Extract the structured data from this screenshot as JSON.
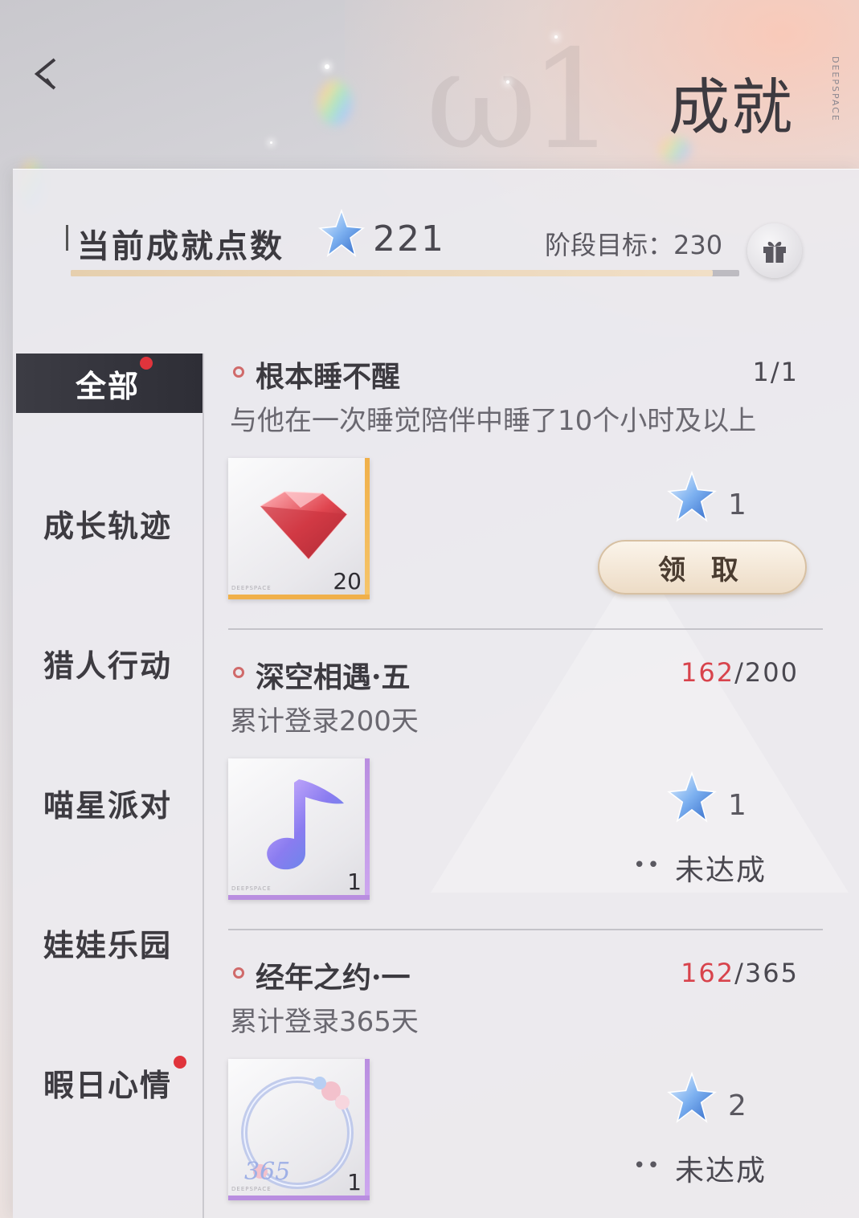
{
  "header": {
    "title": "成就",
    "brand_vertical": "DEEPSPACE"
  },
  "points": {
    "label": "当前成就点数",
    "value": "221",
    "goal_label": "阶段目标：230",
    "progress": 0.96
  },
  "sidebar": {
    "items": [
      {
        "label": "全部",
        "active": true,
        "badge": true
      },
      {
        "label": "成长轨迹",
        "active": false,
        "badge": false
      },
      {
        "label": "猎人行动",
        "active": false,
        "badge": false
      },
      {
        "label": "喵星派对",
        "active": false,
        "badge": false
      },
      {
        "label": "娃娃乐园",
        "active": false,
        "badge": false
      },
      {
        "label": "暇日心情",
        "active": false,
        "badge": true
      }
    ]
  },
  "achievements": [
    {
      "name": "根本睡不醒",
      "progress_current": "",
      "progress_text": "1/1",
      "description": "与他在一次睡觉陪伴中睡了10个小时及以上",
      "reward_icon": "red-diamond-icon",
      "reward_qty": "20",
      "points": "1",
      "action": "领 取"
    },
    {
      "name": "深空相遇·五",
      "progress_current": "162",
      "progress_text": "/200",
      "description": "累计登录200天",
      "reward_icon": "music-note-icon",
      "reward_qty": "1",
      "points": "1",
      "status_dots": "••",
      "status": "未达成"
    },
    {
      "name": "经年之约·一",
      "progress_current": "162",
      "progress_text": "/365",
      "description": "累计登录365天",
      "reward_icon": "floral-frame-icon",
      "reward_overlay": "365",
      "reward_qty": "1",
      "points": "2",
      "status_dots": "••",
      "status": "未达成"
    }
  ],
  "colors": {
    "accent_red": "#d8434c",
    "active_tab": "#2e2e36",
    "claim_button": "#eddcc6"
  }
}
